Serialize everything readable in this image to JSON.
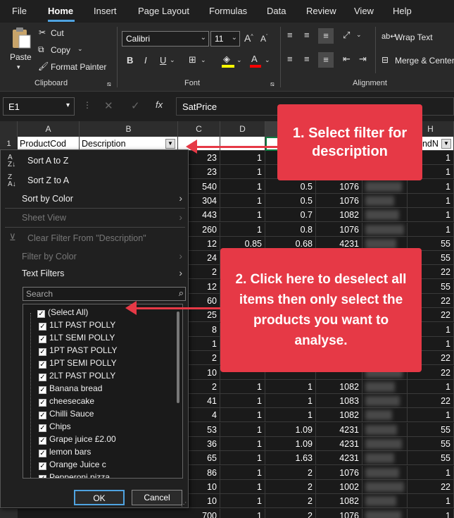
{
  "menu": [
    "File",
    "Home",
    "Insert",
    "Page Layout",
    "Formulas",
    "Data",
    "Review",
    "View",
    "Help"
  ],
  "ribbon": {
    "clipboard": {
      "label": "Clipboard",
      "paste": "Paste",
      "cut": "Cut",
      "copy": "Copy",
      "format_painter": "Format Painter"
    },
    "font": {
      "label": "Font",
      "family": "Calibri",
      "size": "11"
    },
    "alignment": {
      "label": "Alignment",
      "wrap_text": "Wrap Text",
      "merge_center": "Merge & Center"
    }
  },
  "formula_bar": {
    "namebox": "E1",
    "fx": "fx",
    "content": "SatPrice"
  },
  "columns": [
    "A",
    "B",
    "C",
    "D",
    "H"
  ],
  "header_row": {
    "row": "1",
    "a": "ProductCod",
    "b": "Description",
    "h": "undN"
  },
  "rows": [
    {
      "c": "23",
      "d": "1",
      "e": "",
      "f": "",
      "h": "1"
    },
    {
      "c": "23",
      "d": "1",
      "e": "",
      "f": "",
      "h": "1"
    },
    {
      "c": "540",
      "d": "1",
      "e": "0.5",
      "f": "1076",
      "h": "1"
    },
    {
      "c": "304",
      "d": "1",
      "e": "0.5",
      "f": "1076",
      "h": "1"
    },
    {
      "c": "443",
      "d": "1",
      "e": "0.7",
      "f": "1082",
      "h": "1"
    },
    {
      "c": "260",
      "d": "1",
      "e": "0.8",
      "f": "1076",
      "h": "1"
    },
    {
      "c": "12",
      "d": "0.85",
      "e": "0.68",
      "f": "4231",
      "h": "55"
    },
    {
      "c": "24",
      "d": "",
      "e": "",
      "f": "",
      "h": "55"
    },
    {
      "c": "2",
      "d": "",
      "e": "",
      "f": "",
      "h": "22"
    },
    {
      "c": "12",
      "d": "",
      "e": "",
      "f": "",
      "h": "55"
    },
    {
      "c": "60",
      "d": "",
      "e": "",
      "f": "",
      "h": "22"
    },
    {
      "c": "25",
      "d": "",
      "e": "",
      "f": "",
      "h": "22"
    },
    {
      "c": "8",
      "d": "",
      "e": "",
      "f": "",
      "h": "1"
    },
    {
      "c": "1",
      "d": "",
      "e": "",
      "f": "",
      "h": "1"
    },
    {
      "c": "2",
      "d": "",
      "e": "",
      "f": "",
      "h": "22"
    },
    {
      "c": "10",
      "d": "",
      "e": "",
      "f": "",
      "h": "22"
    },
    {
      "c": "2",
      "d": "1",
      "e": "1",
      "f": "1082",
      "h": "1"
    },
    {
      "c": "41",
      "d": "1",
      "e": "1",
      "f": "1083",
      "h": "22"
    },
    {
      "c": "4",
      "d": "1",
      "e": "1",
      "f": "1082",
      "h": "1"
    },
    {
      "c": "53",
      "d": "1",
      "e": "1.09",
      "f": "4231",
      "h": "55"
    },
    {
      "c": "36",
      "d": "1",
      "e": "1.09",
      "f": "4231",
      "h": "55"
    },
    {
      "c": "65",
      "d": "1",
      "e": "1.63",
      "f": "4231",
      "h": "55"
    },
    {
      "c": "86",
      "d": "1",
      "e": "2",
      "f": "1076",
      "h": "1"
    },
    {
      "c": "10",
      "d": "1",
      "e": "2",
      "f": "1002",
      "h": "22"
    },
    {
      "c": "10",
      "d": "1",
      "e": "2",
      "f": "1082",
      "h": "1"
    },
    {
      "c": "700",
      "d": "1",
      "e": "2",
      "f": "1076",
      "h": "1"
    }
  ],
  "filter_menu": {
    "sort_az": "Sort A to Z",
    "sort_za": "Sort Z to A",
    "sort_color": "Sort by Color",
    "sheet_view": "Sheet View",
    "clear_filter": "Clear Filter From \"Description\"",
    "filter_color": "Filter by Color",
    "text_filters": "Text Filters",
    "search_placeholder": "Search",
    "items": [
      "(Select All)",
      "1LT PAST POLLY",
      "1LT SEMI POLLY",
      "1PT PAST POLLY",
      "1PT SEMI POLLY",
      "2LT PAST POLLY",
      "Banana bread",
      "cheesecake",
      "Chilli Sauce",
      "Chips",
      "Grape juice £2.00",
      "lemon bars",
      "Orange Juice c",
      "Pepperoni pizza"
    ],
    "ok": "OK",
    "cancel": "Cancel"
  },
  "callouts": {
    "one": "1. Select filter for description",
    "two": "2. Click here to deselect all items then only select the products you want to analyse."
  }
}
